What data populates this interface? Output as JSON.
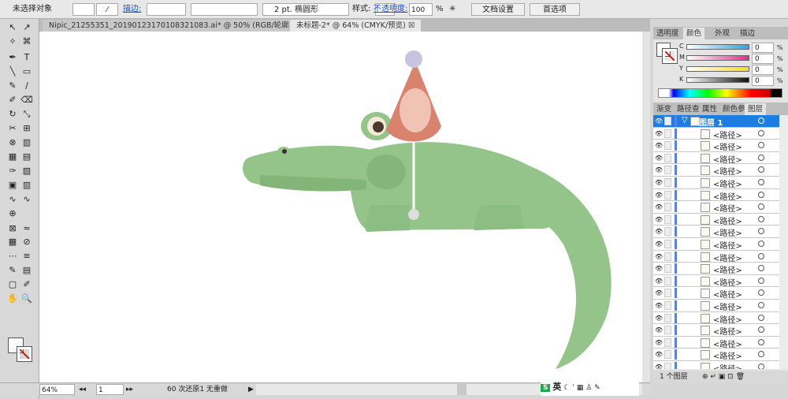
{
  "control_bar": {
    "selection": "未选择对象",
    "stroke_label": "描边:",
    "brush_size": "2 pt. 椭圆形",
    "style_label": "样式:",
    "opacity_label": "不透明度:",
    "opacity_value": "100",
    "opacity_unit": "%",
    "doc_setup": "文档设置",
    "preferences": "首选项"
  },
  "doc_tabs": [
    {
      "label": "Nipic_21255351_20190123170108321083.ai* @ 50% (RGB/轮廓)"
    },
    {
      "label": "未标题-2* @ 64% (CMYK/预览)"
    }
  ],
  "status": {
    "zoom": "64%",
    "page": "1",
    "history": "60 次还原1 无重做"
  },
  "ime": {
    "lang": "英"
  },
  "color_panel": {
    "tabs": [
      "透明度",
      "颜色",
      "外观",
      "描边"
    ],
    "active": 1,
    "channels": [
      {
        "label": "C",
        "value": "0",
        "color": "#2aa8e0"
      },
      {
        "label": "M",
        "value": "0",
        "color": "#e0308a"
      },
      {
        "label": "Y",
        "value": "0",
        "color": "#f0e020"
      },
      {
        "label": "K",
        "value": "0",
        "color": "#111111"
      }
    ],
    "unit": "%"
  },
  "layers_panel": {
    "tabs": [
      "渐变",
      "路径查",
      "属性",
      "颜色参",
      "图层"
    ],
    "active": 4,
    "layer": "图层 1",
    "paths": [
      "<路径>",
      "<路径>",
      "<路径>",
      "<路径>",
      "<路径>",
      "<路径>",
      "<路径>",
      "<路径>",
      "<路径>",
      "<路径>",
      "<路径>",
      "<路径>",
      "<路径>",
      "<路径>",
      "<路径>",
      "<路径>",
      "<路径>",
      "<路径>",
      "<路径>",
      "<路径>"
    ],
    "footer": "1 个图层"
  },
  "colors": {
    "croc": "#95c48a",
    "hat": "#d9826e",
    "selection": "#1d7de0"
  }
}
